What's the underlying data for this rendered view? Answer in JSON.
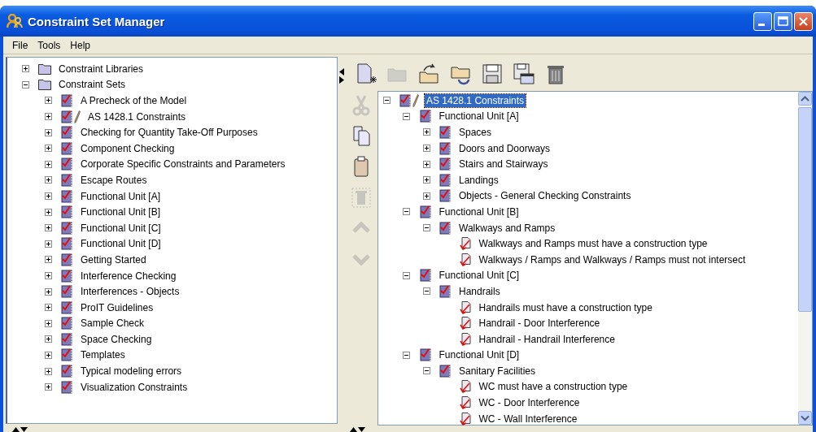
{
  "window": {
    "title": "Constraint Set Manager"
  },
  "menu": [
    "File",
    "Tools",
    "Help"
  ],
  "library_tree": [
    {
      "kind": "folder",
      "label": "Constraint Libraries",
      "expanded": false,
      "selected": false
    },
    {
      "kind": "folder",
      "label": "Constraint Sets",
      "expanded": true,
      "selected": false,
      "children": [
        {
          "kind": "set",
          "label": "A Precheck of the Model",
          "expanded": false,
          "selected": false,
          "editing": false
        },
        {
          "kind": "set",
          "label": "AS 1428.1 Constraints",
          "expanded": false,
          "selected": false,
          "editing": true
        },
        {
          "kind": "set",
          "label": "Checking for Quantity Take-Off Purposes",
          "expanded": false,
          "selected": false,
          "editing": false
        },
        {
          "kind": "set",
          "label": "Component Checking",
          "expanded": false,
          "selected": false,
          "editing": false
        },
        {
          "kind": "set",
          "label": "Corporate Specific Constraints and Parameters",
          "expanded": false,
          "selected": false,
          "editing": false
        },
        {
          "kind": "set",
          "label": "Escape Routes",
          "expanded": false,
          "selected": false,
          "editing": false
        },
        {
          "kind": "set",
          "label": "Functional Unit [A]",
          "expanded": false,
          "selected": false,
          "editing": false
        },
        {
          "kind": "set",
          "label": "Functional Unit [B]",
          "expanded": false,
          "selected": false,
          "editing": false
        },
        {
          "kind": "set",
          "label": "Functional Unit [C]",
          "expanded": false,
          "selected": false,
          "editing": false
        },
        {
          "kind": "set",
          "label": "Functional Unit [D]",
          "expanded": false,
          "selected": false,
          "editing": false
        },
        {
          "kind": "set",
          "label": "Getting Started",
          "expanded": false,
          "selected": false,
          "editing": false
        },
        {
          "kind": "set",
          "label": "Interference Checking",
          "expanded": false,
          "selected": false,
          "editing": false
        },
        {
          "kind": "set",
          "label": "Interferences - Objects",
          "expanded": false,
          "selected": false,
          "editing": false
        },
        {
          "kind": "set",
          "label": "ProIT Guidelines",
          "expanded": false,
          "selected": false,
          "editing": false
        },
        {
          "kind": "set",
          "label": "Sample Check",
          "expanded": false,
          "selected": false,
          "editing": false
        },
        {
          "kind": "set",
          "label": "Space Checking",
          "expanded": false,
          "selected": false,
          "editing": false
        },
        {
          "kind": "set",
          "label": "Templates",
          "expanded": false,
          "selected": false,
          "editing": false
        },
        {
          "kind": "set",
          "label": "Typical modeling errors",
          "expanded": false,
          "selected": false,
          "editing": false
        },
        {
          "kind": "set",
          "label": "Visualization Constraints",
          "expanded": false,
          "selected": false,
          "editing": false
        }
      ]
    }
  ],
  "toolbar": [
    {
      "kind": "new",
      "disabled": false
    },
    {
      "kind": "open",
      "disabled": true
    },
    {
      "kind": "import",
      "disabled": false
    },
    {
      "kind": "reload",
      "disabled": false
    },
    {
      "kind": "save",
      "disabled": false
    },
    {
      "kind": "save_as",
      "disabled": false
    },
    {
      "kind": "delete",
      "disabled": false
    }
  ],
  "edit_toolbar": [
    {
      "kind": "cut",
      "disabled": true
    },
    {
      "kind": "copy",
      "disabled": false
    },
    {
      "kind": "paste",
      "disabled": false
    },
    {
      "kind": "delete",
      "disabled": true
    },
    {
      "kind": "move_up",
      "disabled": true
    },
    {
      "kind": "move_down",
      "disabled": true
    }
  ],
  "set_tree": [
    {
      "kind": "set",
      "label": "AS 1428.1 Constraints",
      "expanded": true,
      "selected": true,
      "editing": true,
      "children": [
        {
          "kind": "set",
          "label": "Functional Unit [A]",
          "expanded": true,
          "selected": false,
          "editing": false,
          "children": [
            {
              "kind": "set",
              "label": "Spaces",
              "expanded": false,
              "selected": false,
              "editing": false
            },
            {
              "kind": "set",
              "label": "Doors and Doorways",
              "expanded": false,
              "selected": false,
              "editing": false
            },
            {
              "kind": "set",
              "label": "Stairs and Stairways",
              "expanded": false,
              "selected": false,
              "editing": false
            },
            {
              "kind": "set",
              "label": "Landings",
              "expanded": false,
              "selected": false,
              "editing": false
            },
            {
              "kind": "set",
              "label": "Objects - General Checking Constraints",
              "expanded": false,
              "selected": false,
              "editing": false
            }
          ]
        },
        {
          "kind": "set",
          "label": "Functional Unit [B]",
          "expanded": true,
          "selected": false,
          "editing": false,
          "children": [
            {
              "kind": "set",
              "label": "Walkways and Ramps",
              "expanded": true,
              "selected": false,
              "editing": false,
              "children": [
                {
                  "kind": "constraint",
                  "label": "Walkways and Ramps must have a construction type",
                  "selected": false
                },
                {
                  "kind": "constraint",
                  "label": "Walkways / Ramps and Walkways / Ramps must not intersect",
                  "selected": false
                }
              ]
            }
          ]
        },
        {
          "kind": "set",
          "label": "Functional Unit [C]",
          "expanded": true,
          "selected": false,
          "editing": false,
          "children": [
            {
              "kind": "set",
              "label": "Handrails",
              "expanded": true,
              "selected": false,
              "editing": false,
              "children": [
                {
                  "kind": "constraint",
                  "label": "Handrails must have a construction type",
                  "selected": false
                },
                {
                  "kind": "constraint",
                  "label": "Handrail - Door Interference",
                  "selected": false
                },
                {
                  "kind": "constraint",
                  "label": "Handrail - Handrail Interference",
                  "selected": false
                }
              ]
            }
          ]
        },
        {
          "kind": "set",
          "label": "Functional Unit [D]",
          "expanded": true,
          "selected": false,
          "editing": false,
          "children": [
            {
              "kind": "set",
              "label": "Sanitary Facilities",
              "expanded": true,
              "selected": false,
              "editing": false,
              "children": [
                {
                  "kind": "constraint",
                  "label": "WC must have a construction type",
                  "selected": false
                },
                {
                  "kind": "constraint",
                  "label": "WC - Door Interference",
                  "selected": false
                },
                {
                  "kind": "constraint",
                  "label": "WC - Wall Interference",
                  "selected": false
                }
              ]
            }
          ]
        }
      ]
    }
  ]
}
